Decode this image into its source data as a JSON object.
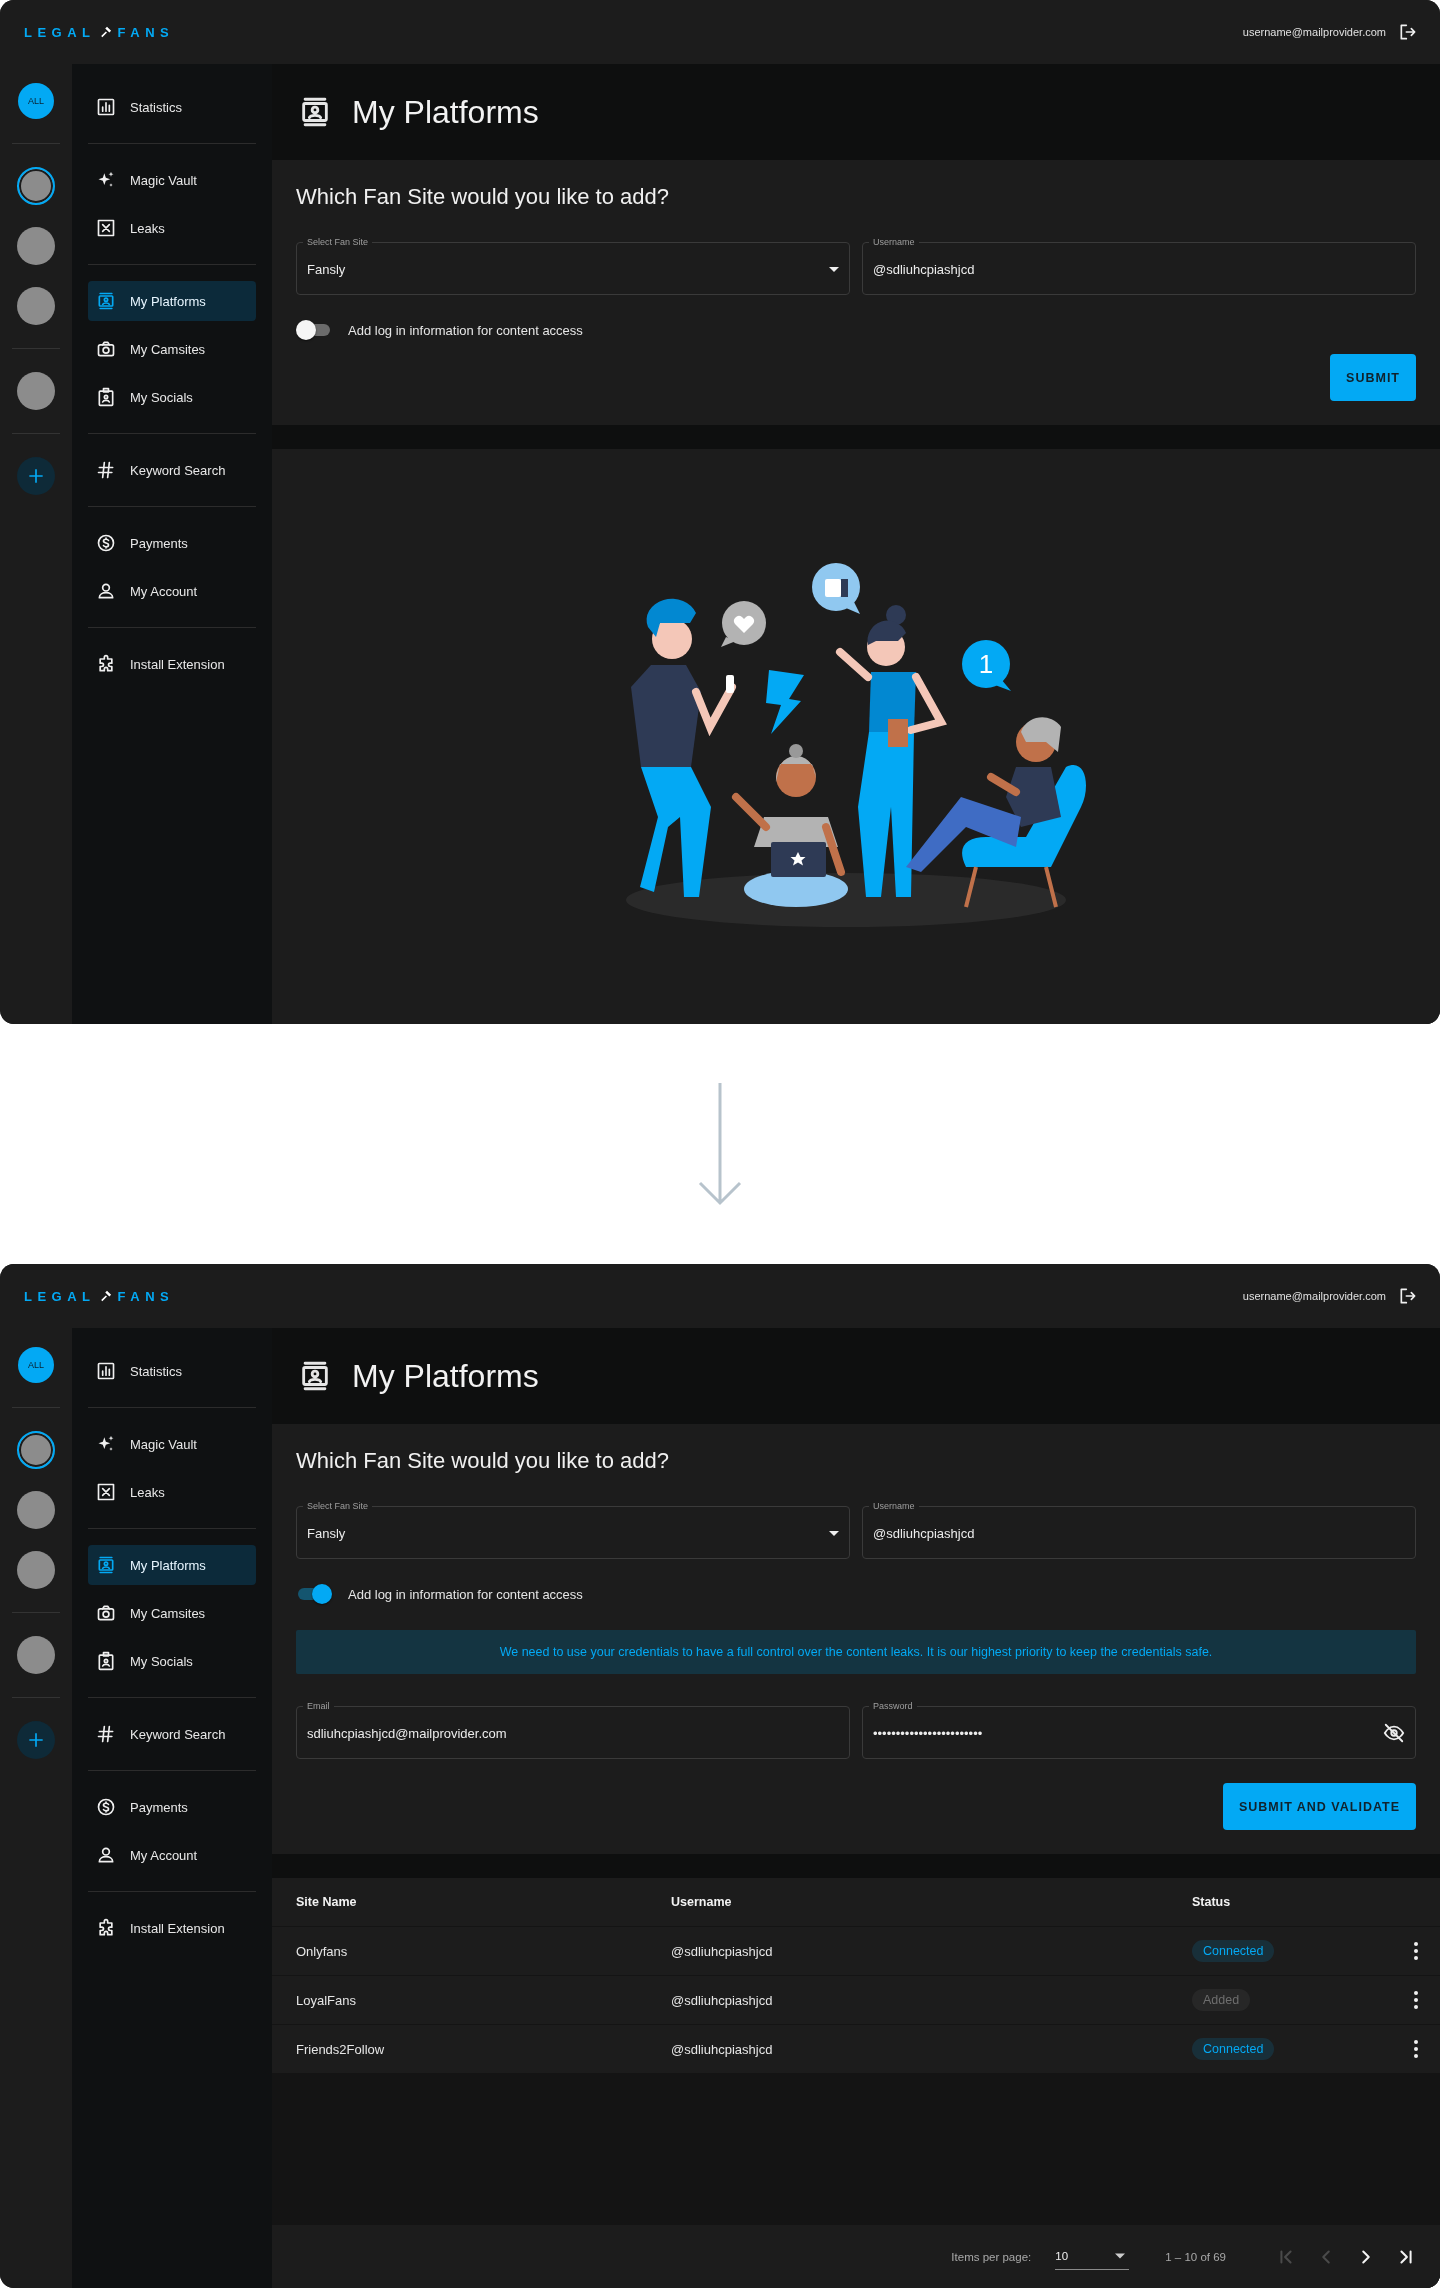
{
  "screens": [
    {
      "brand": {
        "left": "LEGAL",
        "right": "FANS"
      },
      "user_email": "username@mailprovider.com",
      "rail": {
        "all_label": "ALL",
        "avatar_groups": [
          {
            "avatars": [
              {
                "selected": true
              },
              {
                "selected": false
              },
              {
                "selected": false
              }
            ]
          },
          {
            "avatars": [
              {
                "selected": false
              }
            ]
          }
        ]
      },
      "nav_groups": [
        {
          "items": [
            {
              "label": "Statistics",
              "selected": false
            }
          ]
        },
        {
          "items": [
            {
              "label": "Magic Vault",
              "selected": false
            },
            {
              "label": "Leaks",
              "selected": false
            }
          ]
        },
        {
          "items": [
            {
              "label": "My Platforms",
              "selected": true
            },
            {
              "label": "My Camsites",
              "selected": false
            },
            {
              "label": "My Socials",
              "selected": false
            }
          ]
        },
        {
          "items": [
            {
              "label": "Keyword Search",
              "selected": false
            }
          ]
        },
        {
          "items": [
            {
              "label": "Payments",
              "selected": false
            },
            {
              "label": "My Account",
              "selected": false
            }
          ]
        },
        {
          "items": [
            {
              "label": "Install Extension",
              "selected": false
            }
          ]
        }
      ],
      "page_title": "My Platforms",
      "form": {
        "heading": "Which Fan Site would you like to add?",
        "site_select": {
          "label": "Select Fan Site",
          "value": "Fansly"
        },
        "username": {
          "label": "Username",
          "value": "@sdliuhcpiashjcd"
        },
        "login_toggle": {
          "label": "Add log in information for content access",
          "on": false
        },
        "submit_label": "SUBMIT"
      },
      "lower_panel": {
        "kind": "illustration",
        "bubble_count": "1"
      }
    },
    {
      "brand": {
        "left": "LEGAL",
        "right": "FANS"
      },
      "user_email": "username@mailprovider.com",
      "rail": {
        "all_label": "ALL",
        "avatar_groups": [
          {
            "avatars": [
              {
                "selected": true
              },
              {
                "selected": false
              },
              {
                "selected": false
              }
            ]
          },
          {
            "avatars": [
              {
                "selected": false
              }
            ]
          }
        ]
      },
      "nav_groups": [
        {
          "items": [
            {
              "label": "Statistics",
              "selected": false
            }
          ]
        },
        {
          "items": [
            {
              "label": "Magic Vault",
              "selected": false
            },
            {
              "label": "Leaks",
              "selected": false
            }
          ]
        },
        {
          "items": [
            {
              "label": "My Platforms",
              "selected": true
            },
            {
              "label": "My Camsites",
              "selected": false
            },
            {
              "label": "My Socials",
              "selected": false
            }
          ]
        },
        {
          "items": [
            {
              "label": "Keyword Search",
              "selected": false
            }
          ]
        },
        {
          "items": [
            {
              "label": "Payments",
              "selected": false
            },
            {
              "label": "My Account",
              "selected": false
            }
          ]
        },
        {
          "items": [
            {
              "label": "Install Extension",
              "selected": false
            }
          ]
        }
      ],
      "page_title": "My Platforms",
      "form": {
        "heading": "Which Fan Site would you like to add?",
        "site_select": {
          "label": "Select Fan Site",
          "value": "Fansly"
        },
        "username": {
          "label": "Username",
          "value": "@sdliuhcpiashjcd"
        },
        "login_toggle": {
          "label": "Add log in information for content access",
          "on": true
        },
        "notice": "We need to use your credentials to have a full control over the content leaks. It is our highest priority to keep the credentials safe.",
        "email": {
          "label": "Email",
          "value": "sdliuhcpiashjcd@mailprovider.com"
        },
        "password": {
          "label": "Password",
          "value": "••••••••••••••••••••••••"
        },
        "submit_label": "SUBMIT AND VALIDATE"
      },
      "lower_panel": {
        "kind": "table",
        "columns": [
          "Site Name",
          "Username",
          "Status"
        ],
        "rows": [
          {
            "site": "Onlyfans",
            "username": "@sdliuhcpiashjcd",
            "status": "Connected",
            "color": "#03a9f4"
          },
          {
            "site": "LoyalFans",
            "username": "@sdliuhcpiashjcd",
            "status": "Added",
            "color": "#6e6e6e"
          },
          {
            "site": "Friends2Follow",
            "username": "@sdliuhcpiashjcd",
            "status": "Connected",
            "color": "#03a9f4"
          }
        ],
        "pagination": {
          "items_label": "Items per page:",
          "page_size": "10",
          "range": "1 – 10 of 69",
          "buttons": [
            {
              "kind": "first",
              "disabled": true
            },
            {
              "kind": "prev",
              "disabled": true
            },
            {
              "kind": "next",
              "disabled": false
            },
            {
              "kind": "last",
              "disabled": false
            }
          ]
        }
      }
    }
  ]
}
